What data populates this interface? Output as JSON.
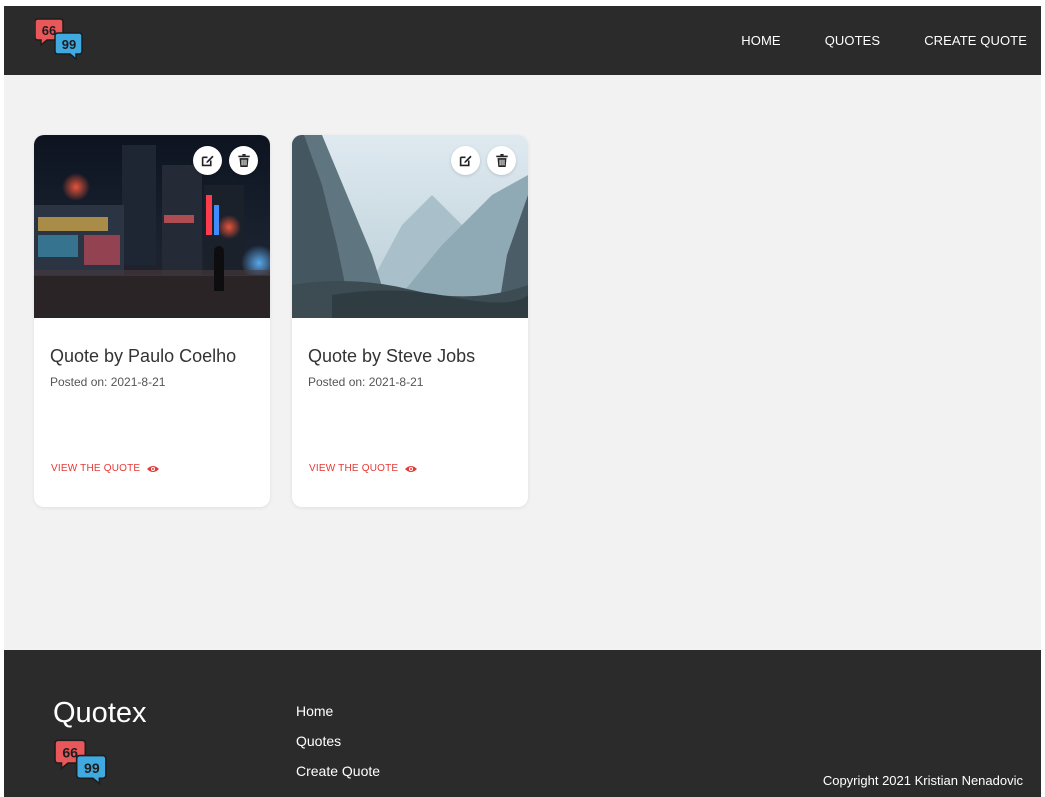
{
  "nav": {
    "logo_icon": "quote-bubbles-logo",
    "links": [
      {
        "label": "HOME"
      },
      {
        "label": "QUOTES"
      },
      {
        "label": "CREATE QUOTE"
      }
    ]
  },
  "cards": [
    {
      "title": "Quote by Paulo Coelho",
      "date": "Posted on: 2021-8-21",
      "link_label": "VIEW THE QUOTE",
      "image": "night-city-street-photo"
    },
    {
      "title": "Quote by Steve Jobs",
      "date": "Posted on: 2021-8-21",
      "link_label": "VIEW THE QUOTE",
      "image": "misty-mountain-valley-photo"
    }
  ],
  "footer": {
    "brand": "Quotex",
    "links": [
      {
        "label": "Home"
      },
      {
        "label": "Quotes"
      },
      {
        "label": "Create Quote"
      }
    ],
    "copyright": "Copyright 2021 Kristian Nenadovic"
  },
  "colors": {
    "header_bg": "#2b2b2b",
    "page_bg": "#f2f2f2",
    "accent": "#e53935",
    "logo_red": "#e8575a",
    "logo_blue": "#3fa9e0"
  }
}
